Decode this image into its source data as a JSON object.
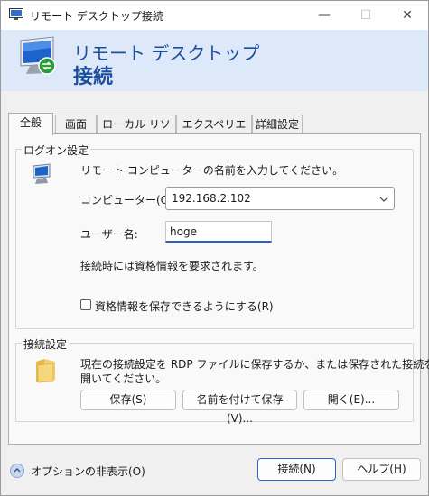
{
  "window": {
    "title": "リモート デスクトップ接続",
    "controls": {
      "minimize": "—",
      "maximize": "☐",
      "close": "✕"
    }
  },
  "banner": {
    "line1": "リモート デスクトップ",
    "line2": "接続"
  },
  "tabs": [
    {
      "label": "全般",
      "active": true
    },
    {
      "label": "画面"
    },
    {
      "label": "ローカル リソース"
    },
    {
      "label": "エクスペリエンス"
    },
    {
      "label": "詳細設定"
    }
  ],
  "logon": {
    "legend": "ログオン設定",
    "instruction": "リモート コンピューターの名前を入力してください。",
    "computer_label": "コンピューター(C):",
    "computer_value": "192.168.2.102",
    "username_label": "ユーザー名:",
    "username_value": "hoge",
    "credential_note": "接続時には資格情報を要求されます。",
    "save_credentials_label": "資格情報を保存できるようにする(R)",
    "save_credentials_checked": false
  },
  "connection": {
    "legend": "接続設定",
    "description_line1": "現在の接続設定を RDP ファイルに保存するか、または保存された接続を",
    "description_line2": "開いてください。",
    "save_button": "保存(S)",
    "save_as_button": "名前を付けて保存(V)...",
    "open_button": "開く(E)..."
  },
  "footer": {
    "hide_options": "オプションの非表示(O)",
    "connect_button": "接続(N)",
    "help_button": "ヘルプ(H)"
  },
  "colors": {
    "banner_bg": "#dde9f8",
    "banner_text": "#1d4f9e",
    "accent": "#2b63c8"
  }
}
